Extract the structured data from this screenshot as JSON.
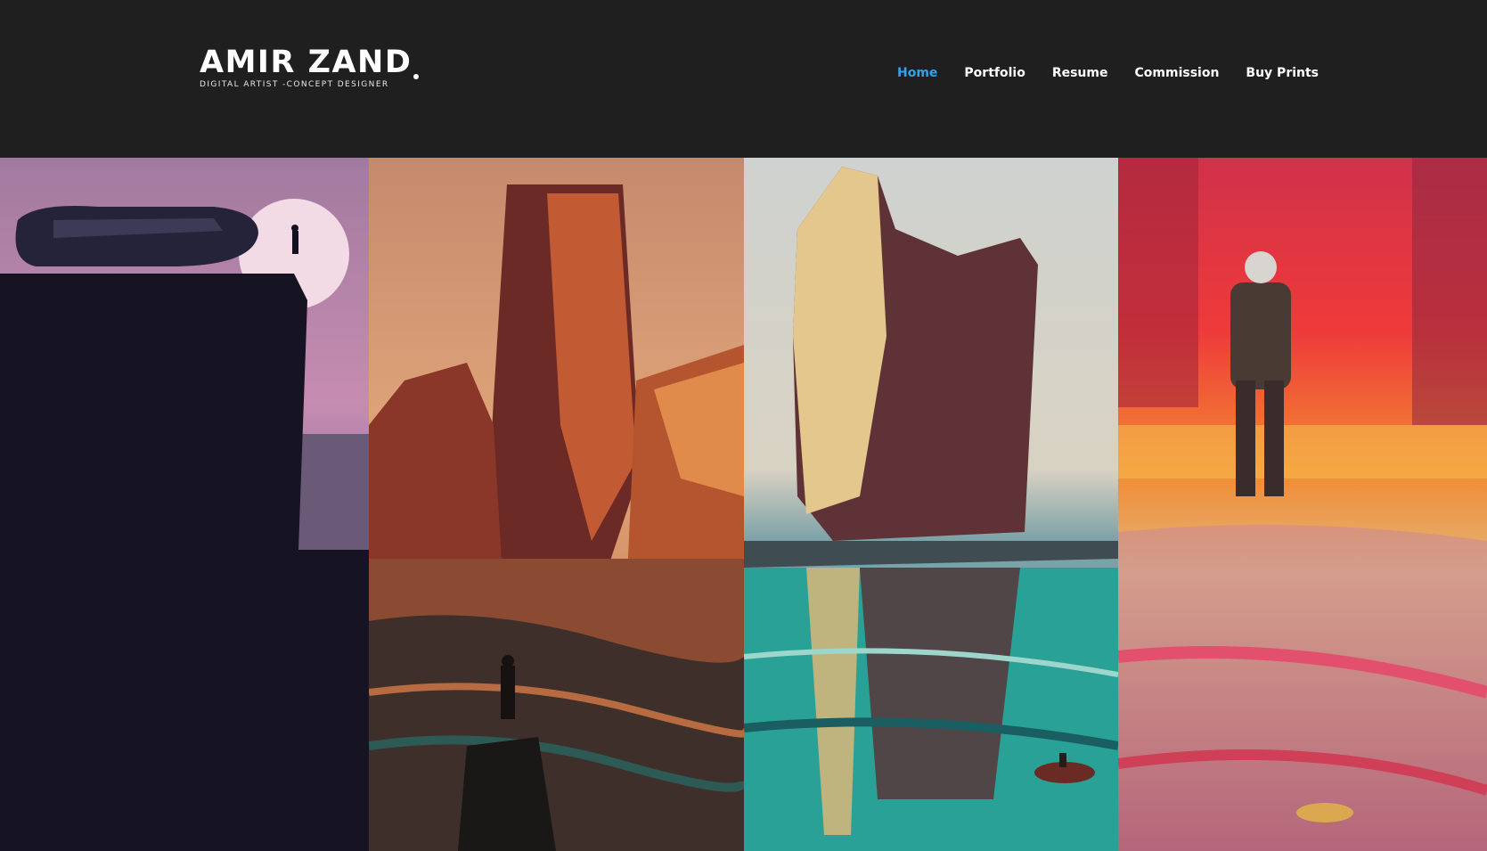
{
  "logo": {
    "title": "AMIR ZAND",
    "subtitle": "DIGITAL ARTIST -CONCEPT DESIGNER"
  },
  "nav": {
    "items": [
      {
        "label": "Home",
        "active": true
      },
      {
        "label": "Portfolio",
        "active": false
      },
      {
        "label": "Resume",
        "active": false
      },
      {
        "label": "Commission",
        "active": false
      },
      {
        "label": "Buy Prints",
        "active": false
      }
    ]
  },
  "colors": {
    "background": "#1f1f1f",
    "accent": "#2ea3f2",
    "nav_text": "#ffffff"
  },
  "gallery": {
    "artworks": [
      {
        "subject": "spaceship on cliff with figure and moon",
        "palette": "purple dusk"
      },
      {
        "subject": "desert mesas with lone figure",
        "palette": "orange red"
      },
      {
        "subject": "sea stack rock with boat",
        "palette": "teal sunset"
      },
      {
        "subject": "astronaut walking in neon light",
        "palette": "red orange"
      }
    ]
  }
}
